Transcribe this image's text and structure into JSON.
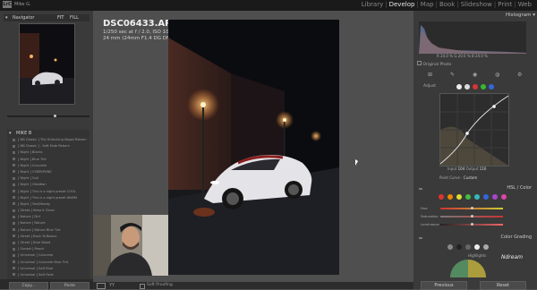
{
  "app": {
    "logo": "LrC",
    "user": "Mike G."
  },
  "modules": [
    "Library",
    "Develop",
    "Map",
    "Book",
    "Slideshow",
    "Print",
    "Web"
  ],
  "active_module": "Develop",
  "left": {
    "navigator_title": "Navigator",
    "zoom_options": [
      "FIT",
      "FILL"
    ],
    "presets_title": "MIKE B",
    "presets": [
      "[ NB Classic ] The Unfucking Illegal Reborn",
      "[ NB Classic ] - Soft Fade Reborn",
      "[ Night ] Blacks",
      "[ Night ] Blue Tint",
      "[ Night ] Concrete",
      "[ Night ] CYBERPUNK",
      "[ Night ] Gull",
      "[ Night ] Obsidian",
      "[ Night ] This is a night preset COOL",
      "[ Night ] This is a night preset WARM",
      "[ Night ] Teal/Moody",
      "[ Street ] Keep it Clean",
      "[ Nature ] Dirt",
      "[ Nature ] Nature",
      "[ Nature ] Nature Blue Tint",
      "[ Street ] Back To Basics",
      "[ Street ] Blue Wood",
      "[ Sunset ] Peach",
      "[ Universal ] Concrete",
      "[ Universal ] Concrete Blue Tint",
      "[ Universal ] Soft Blue",
      "[ Universal ] Soft Fade",
      "[ Universal ] Soft Fade (2)"
    ],
    "copy_label": "Copy...",
    "paste_label": "Paste"
  },
  "photo": {
    "filename": "DSC06433.ARW",
    "exposure": "1/250 sec at f / 2.0, ISO 1000",
    "lens": "24 mm (24mm F1.4 DG DN | Art 022)"
  },
  "toolbar": {
    "soft_proofing": "Soft Proofing"
  },
  "right": {
    "histogram_title": "Histogram",
    "histo_readout": [
      "24.0",
      "20.0",
      "24.0"
    ],
    "original_photo": "Original Photo",
    "adjust_label": "Adjust",
    "tone_curve_readout": [
      "Input",
      "104",
      "Output",
      "116"
    ],
    "point_curve_label": "Point Curve",
    "point_curve_value": "Custom",
    "hsl_title": "HSL / Color",
    "hsl_rows": [
      "Hue",
      "Saturation",
      "Luminance"
    ],
    "color_grading_title": "Color Grading",
    "highlights_label": "Highlights",
    "previous_label": "Previous",
    "reset_label": "Reset",
    "swatch_colors": [
      "#d33",
      "#e80",
      "#dd3",
      "#4b4",
      "#3bb",
      "#36d",
      "#a4c",
      "#d4a"
    ]
  }
}
